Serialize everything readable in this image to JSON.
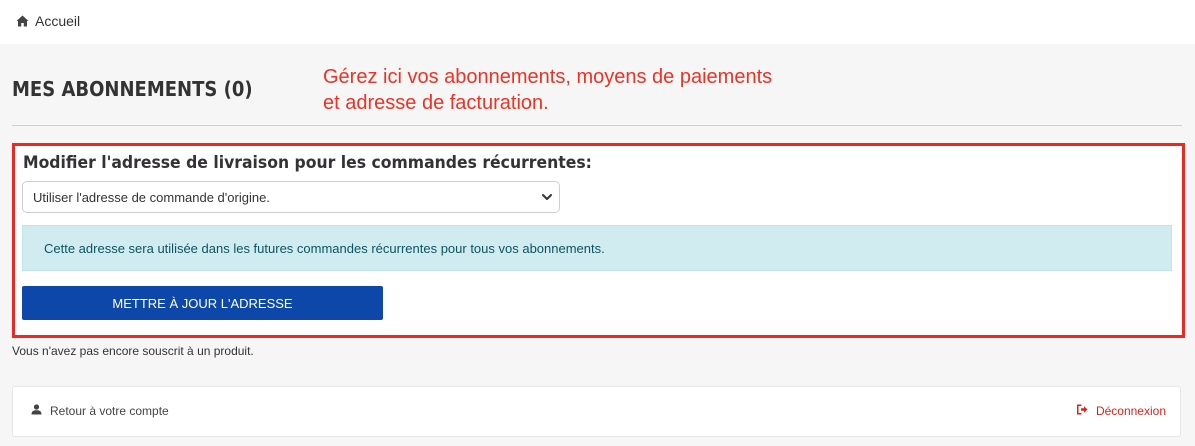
{
  "breadcrumb": {
    "home_label": "Accueil",
    "home_icon": "home-icon"
  },
  "page": {
    "title": "MES ABONNEMENTS (0)",
    "annotation_line1": "Gérez ici vos abonnements, moyens de paiements",
    "annotation_line2": "et adresse de facturation.",
    "empty_note": "Vous n'avez pas encore souscrit à un produit."
  },
  "address_form": {
    "title": "Modifier l'adresse de livraison pour les commandes récurrentes:",
    "select_value": "Utiliser l'adresse de commande d'origine.",
    "info_text": "Cette adresse sera utilisée dans les futures commandes récurrentes pour tous vos abonnements.",
    "submit_label": "METTRE À JOUR L'ADRESSE"
  },
  "footer": {
    "back_label": "Retour à votre compte",
    "logout_label": "Déconnexion"
  },
  "colors": {
    "accent_red": "#ee2722",
    "button_blue": "#0d47a9",
    "info_bg": "#d1ecf1"
  }
}
